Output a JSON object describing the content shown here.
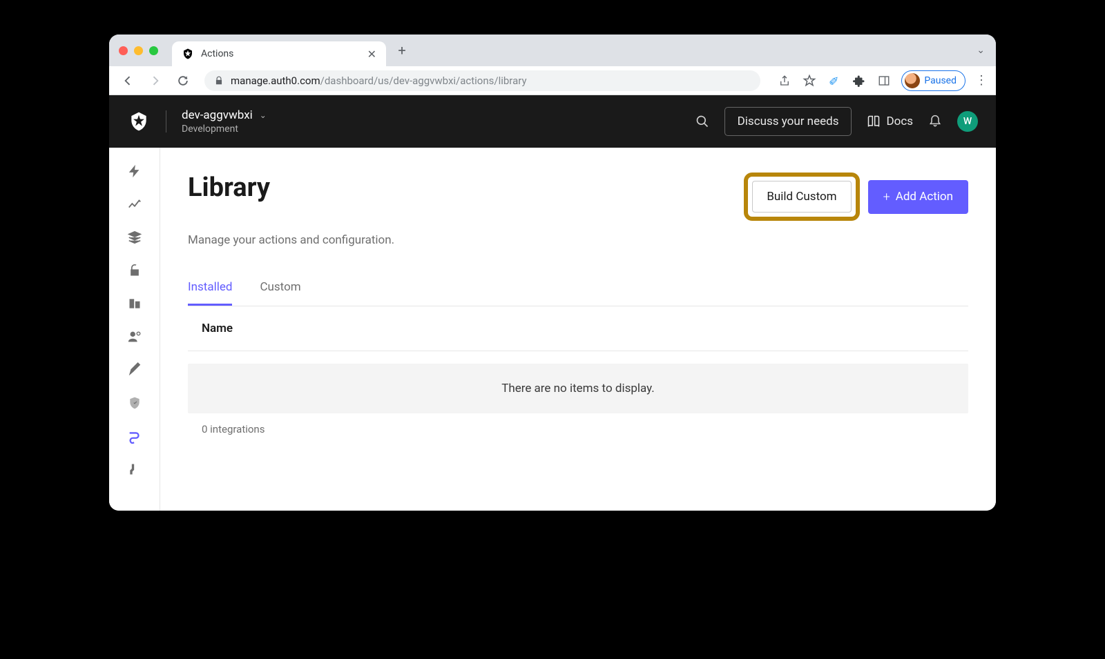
{
  "browser": {
    "tab_title": "Actions",
    "url_host": "manage.auth0.com",
    "url_path": "/dashboard/us/dev-aggvwbxi/actions/library",
    "paused_label": "Paused"
  },
  "header": {
    "tenant_name": "dev-aggvwbxi",
    "tenant_env": "Development",
    "discuss_label": "Discuss your needs",
    "docs_label": "Docs",
    "avatar_letter": "W"
  },
  "page": {
    "title": "Library",
    "subtitle": "Manage your actions and configuration.",
    "build_custom_label": "Build Custom",
    "add_action_label": "Add Action"
  },
  "tabs": {
    "installed": "Installed",
    "custom": "Custom"
  },
  "table": {
    "col_name": "Name",
    "empty_message": "There are no items to display.",
    "count_text": "0 integrations"
  }
}
